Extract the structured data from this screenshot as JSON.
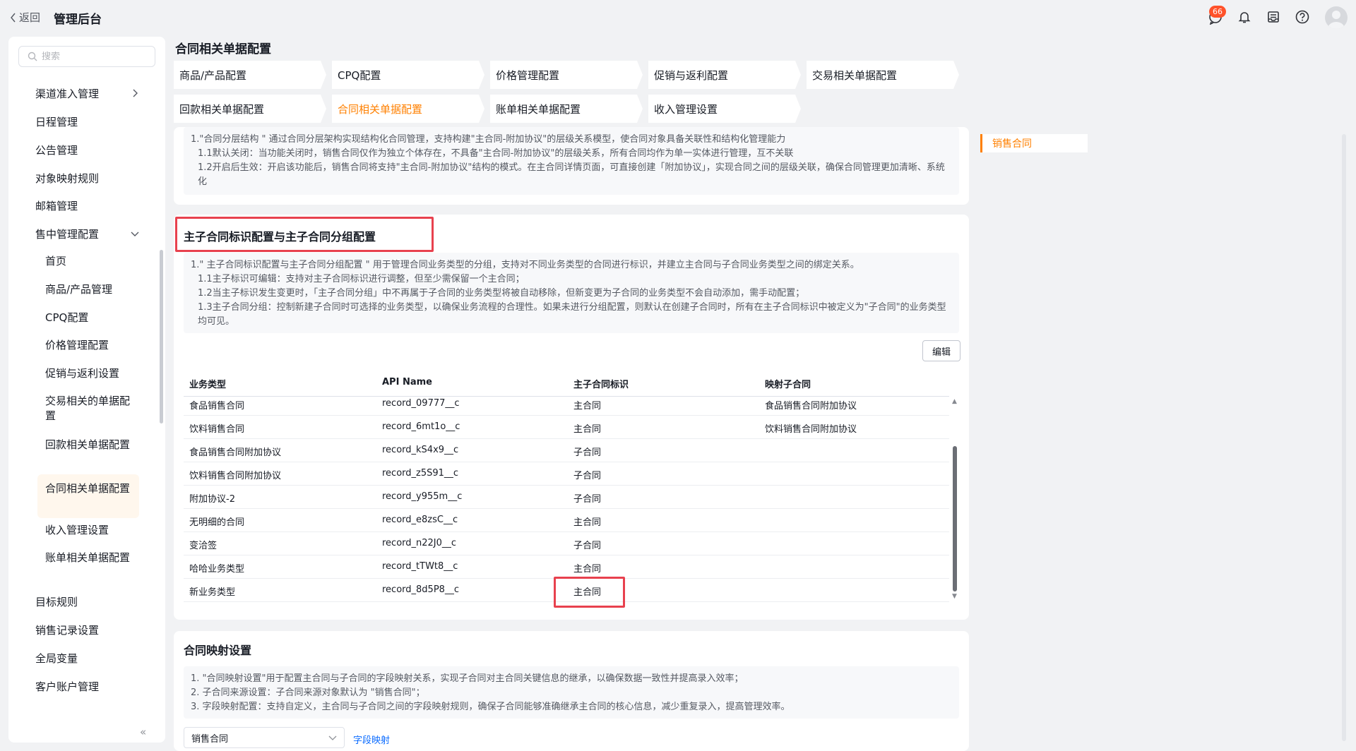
{
  "topbar": {
    "back_label": "返回",
    "title": "管理后台",
    "badge_count": "66"
  },
  "sidebar": {
    "search_placeholder": "搜索",
    "items": [
      {
        "label": "渠道准入管理"
      },
      {
        "label": "日程管理"
      },
      {
        "label": "公告管理"
      },
      {
        "label": "对象映射规则"
      },
      {
        "label": "邮箱管理"
      },
      {
        "label": "售中管理配置"
      }
    ],
    "sub_items": [
      {
        "label": "首页"
      },
      {
        "label": "商品/产品管理"
      },
      {
        "label": "CPQ配置"
      },
      {
        "label": "价格管理配置"
      },
      {
        "label": "促销与返利设置"
      },
      {
        "label": "交易相关的单据配置"
      },
      {
        "label": "回款相关单据配置"
      },
      {
        "label": "合同相关单据配置"
      },
      {
        "label": "收入管理设置"
      },
      {
        "label": "账单相关单据配置"
      }
    ],
    "bottom_items": [
      {
        "label": "目标规则"
      },
      {
        "label": "销售记录设置"
      },
      {
        "label": "全局变量"
      },
      {
        "label": "客户账户管理"
      }
    ]
  },
  "main": {
    "title": "合同相关单据配置",
    "tabs": [
      {
        "label": "商品/产品配置"
      },
      {
        "label": "CPQ配置"
      },
      {
        "label": "价格管理配置"
      },
      {
        "label": "促销与返利配置"
      },
      {
        "label": "交易相关单据配置"
      },
      {
        "label": "回款相关单据配置"
      },
      {
        "label": "合同相关单据配置"
      },
      {
        "label": "账单相关单据配置"
      },
      {
        "label": "收入管理设置"
      }
    ],
    "top_note": [
      "1.\"合同分层结构 \" 通过合同分层架构实现结构化合同管理，支持构建\"主合同-附加协议\"的层级关系模型，使合同对象具备关联性和结构化管理能力",
      "1.1默认关闭：当功能关闭时，销售合同仅作为独立个体存在，不具备\"主合同-附加协议\"的层级关系，所有合同均作为单一实体进行管理，互不关联",
      "1.2开启后生效：开启该功能后，销售合同将支持\"主合同-附加协议\"结构的模式。在主合同详情页面，可直接创建「附加协议」，实现合同之间的层级关联，确保合同管理更加清晰、系统化"
    ],
    "section2": {
      "title": "主子合同标识配置与主子合同分组配置",
      "note": [
        "1.\" 主子合同标识配置与主子合同分组配置 \" 用于管理合同业务类型的分组，支持对不同业务类型的合同进行标识，并建立主合同与子合同业务类型之间的绑定关系。",
        "1.1主子标识可编辑：支持对主子合同标识进行调整，但至少需保留一个主合同；",
        "1.2当主子标识发生变更时，「主子合同分组」中不再属于子合同的业务类型将被自动移除，但新变更为子合同的业务类型不会自动添加，需手动配置；",
        "1.3主子合同分组：控制新建子合同时可选择的业务类型，以确保业务流程的合理性。如果未进行分组配置，则默认在创建子合同时，所有在主子合同标识中被定义为\"子合同\"的业务类型均可见。"
      ],
      "edit_label": "编辑",
      "columns": [
        "业务类型",
        "API Name",
        "主子合同标识",
        "映射子合同"
      ],
      "rows": [
        {
          "type": "食品销售合同",
          "api": "record_09777__c",
          "flag": "主合同",
          "mapped": "食品销售合同附加协议"
        },
        {
          "type": "饮料销售合同",
          "api": "record_6mt1o__c",
          "flag": "主合同",
          "mapped": "饮料销售合同附加协议"
        },
        {
          "type": "食品销售合同附加协议",
          "api": "record_kS4x9__c",
          "flag": "子合同",
          "mapped": ""
        },
        {
          "type": "饮料销售合同附加协议",
          "api": "record_z5S91__c",
          "flag": "子合同",
          "mapped": ""
        },
        {
          "type": "附加协议-2",
          "api": "record_y955m__c",
          "flag": "子合同",
          "mapped": ""
        },
        {
          "type": "无明细的合同",
          "api": "record_e8zsC__c",
          "flag": "主合同",
          "mapped": ""
        },
        {
          "type": "变洽签",
          "api": "record_n22J0__c",
          "flag": "子合同",
          "mapped": ""
        },
        {
          "type": "哈哈业务类型",
          "api": "record_tTWt8__c",
          "flag": "主合同",
          "mapped": ""
        },
        {
          "type": "新业务类型",
          "api": "record_8d5P8__c",
          "flag": "主合同",
          "mapped": ""
        }
      ]
    },
    "section3": {
      "title": "合同映射设置",
      "note": [
        "1. \"合同映射设置\"用于配置主合同与子合同的字段映射关系，实现子合同对主合同关键信息的继承，以确保数据一致性并提高录入效率；",
        "2. 子合同来源设置：子合同来源对象默认为 \"销售合同\"；",
        "3. 字段映射配置：支持自定义，主合同与子合同之间的字段映射规则，确保子合同能够准确继承主合同的核心信息，减少重复录入，提高管理效率。"
      ],
      "select_value": "销售合同",
      "link_label": "字段映射"
    },
    "anchor_label": "销售合同"
  },
  "colors": {
    "accent": "#ff8000",
    "highlight": "#e8414e",
    "link": "#0c6cff"
  }
}
